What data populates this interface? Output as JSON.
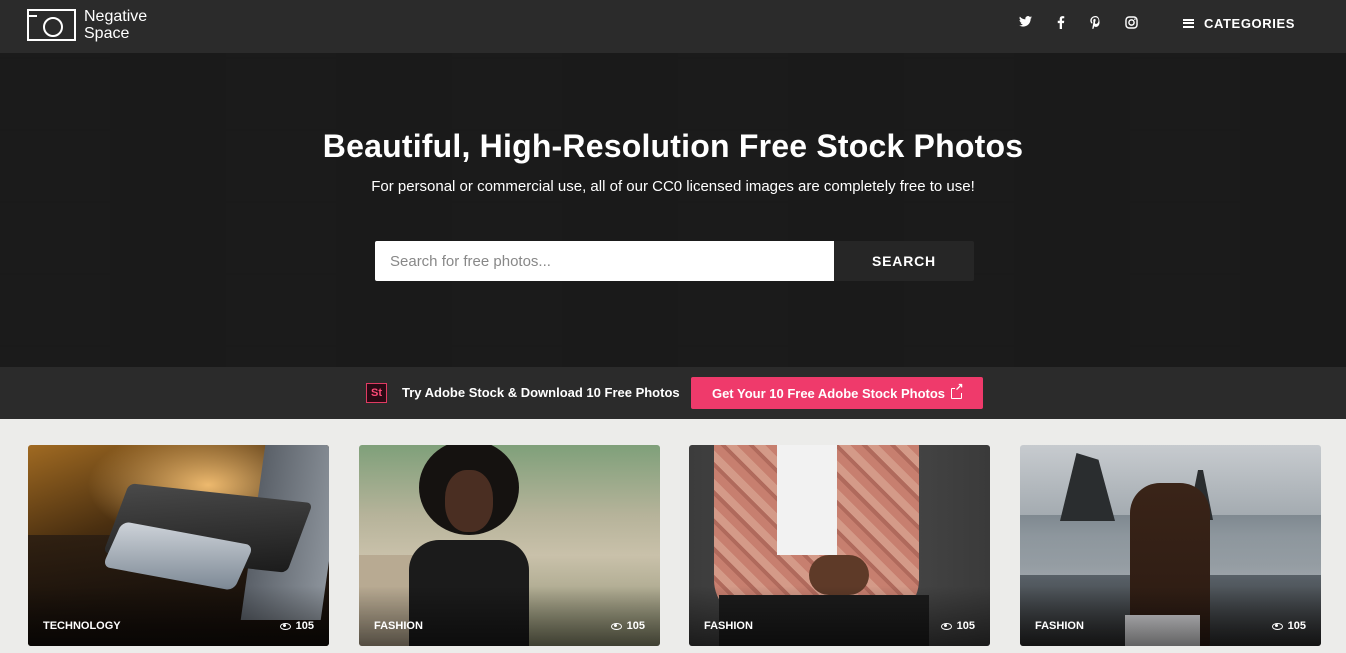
{
  "header": {
    "logo_line1": "Negative",
    "logo_line2": "Space",
    "social": [
      "twitter-icon",
      "facebook-icon",
      "pinterest-icon",
      "instagram-icon"
    ],
    "categories_label": "CATEGORIES"
  },
  "hero": {
    "title": "Beautiful, High-Resolution Free Stock Photos",
    "subtitle": "For personal or commercial use, all of our CC0 licensed images are completely free to use!",
    "search_placeholder": "Search for free photos...",
    "search_button": "SEARCH"
  },
  "promo": {
    "badge": "St",
    "text": "Try Adobe Stock & Download 10 Free Photos",
    "button": "Get Your 10 Free Adobe Stock Photos"
  },
  "cards": [
    {
      "category": "TECHNOLOGY",
      "views": "105"
    },
    {
      "category": "FASHION",
      "views": "105"
    },
    {
      "category": "FASHION",
      "views": "105"
    },
    {
      "category": "FASHION",
      "views": "105"
    }
  ],
  "colors": {
    "accent": "#ef3a6b",
    "topbar": "#2b2b2b",
    "page_bg": "#ececea"
  }
}
